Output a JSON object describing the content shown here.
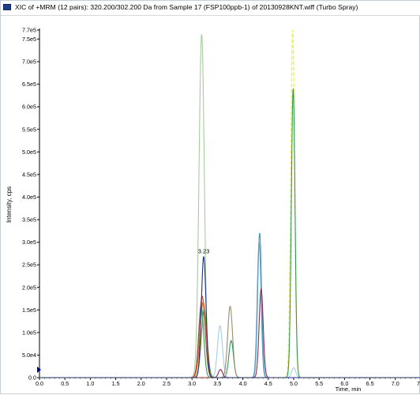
{
  "window": {
    "title": "XIC of +MRM (12 pairs): 320.200/302.200 Da  from Sample 17 (FSP100ppb-1) of 20130928KNT.wiff (Turbo Spray)",
    "icon": "chromatogram-window-icon"
  },
  "colors": {
    "accent": "#1f3f8a",
    "axis": "#000000",
    "cursor": "#00008b"
  },
  "chart_data": {
    "type": "line",
    "title": "",
    "xlabel": "Time, min",
    "ylabel": "Intensity, cps",
    "xlim": [
      0,
      7.5
    ],
    "ylim": [
      0,
      770000
    ],
    "grid": false,
    "legend": "none",
    "x_ticks": [
      0.0,
      0.5,
      1.0,
      1.5,
      2.0,
      2.5,
      3.0,
      3.5,
      4.0,
      4.5,
      5.0,
      5.5,
      6.0,
      6.5,
      7.0,
      7.5
    ],
    "x_tick_labels": [
      "0.0",
      "0.5",
      "1.0",
      "1.5",
      "2.0",
      "2.5",
      "3.0",
      "3.5",
      "4.0",
      "4.5",
      "5.0",
      "5.5",
      "6.0",
      "6.5",
      "7.0",
      "7.5"
    ],
    "y_ticks": [
      0,
      50000,
      100000,
      150000,
      200000,
      250000,
      300000,
      350000,
      400000,
      450000,
      500000,
      550000,
      600000,
      650000,
      700000,
      750000,
      770000
    ],
    "y_tick_labels": [
      "0.0",
      "5.0e4",
      "1.0e5",
      "1.5e5",
      "2.0e5",
      "2.5e5",
      "3.0e5",
      "3.5e5",
      "4.0e5",
      "4.5e5",
      "5.0e5",
      "5.5e5",
      "6.0e5",
      "6.5e5",
      "7.0e5",
      "7.5e5",
      "7.7e5"
    ],
    "annotations": [
      {
        "text": "3.23",
        "x": 3.23,
        "y": 270000
      }
    ],
    "series": [
      {
        "color": "#a8cba0",
        "peaks": [
          {
            "rt": 3.19,
            "height": 760000,
            "sigma": 0.052
          }
        ]
      },
      {
        "color": "#f0f064",
        "dashed": true,
        "peaks": [
          {
            "rt": 4.98,
            "height": 770000,
            "sigma": 0.038
          }
        ]
      },
      {
        "color": "#2f9a52",
        "peaks": [
          {
            "rt": 4.99,
            "height": 640000,
            "sigma": 0.036
          },
          {
            "rt": 3.77,
            "height": 82000,
            "sigma": 0.045
          },
          {
            "rt": 3.18,
            "height": 160000,
            "sigma": 0.05
          }
        ]
      },
      {
        "color": "#3a9ab8",
        "peaks": [
          {
            "rt": 4.33,
            "height": 320000,
            "sigma": 0.038
          }
        ]
      },
      {
        "color": "#6aa0c8",
        "peaks": [
          {
            "rt": 4.32,
            "height": 300000,
            "sigma": 0.038
          }
        ]
      },
      {
        "color": "#a3cdea",
        "peaks": [
          {
            "rt": 3.55,
            "height": 115000,
            "sigma": 0.048
          },
          {
            "rt": 5.0,
            "height": 22000,
            "sigma": 0.04
          }
        ]
      },
      {
        "color": "#9a8c6e",
        "peaks": [
          {
            "rt": 3.75,
            "height": 158000,
            "sigma": 0.048
          }
        ]
      },
      {
        "color": "#8b2b58",
        "peaks": [
          {
            "rt": 4.36,
            "height": 196000,
            "sigma": 0.04
          },
          {
            "rt": 3.56,
            "height": 18000,
            "sigma": 0.04
          }
        ]
      },
      {
        "color": "#c43a2a",
        "peaks": [
          {
            "rt": 3.2,
            "height": 180000,
            "sigma": 0.058
          }
        ]
      },
      {
        "color": "#d8701e",
        "peaks": [
          {
            "rt": 3.22,
            "height": 168000,
            "sigma": 0.06
          }
        ]
      },
      {
        "color": "#4c9c3a",
        "peaks": [
          {
            "rt": 3.24,
            "height": 150000,
            "sigma": 0.056
          }
        ]
      },
      {
        "color": "#1e2f8c",
        "peaks": [
          {
            "rt": 3.23,
            "height": 268000,
            "sigma": 0.046
          }
        ]
      }
    ]
  }
}
